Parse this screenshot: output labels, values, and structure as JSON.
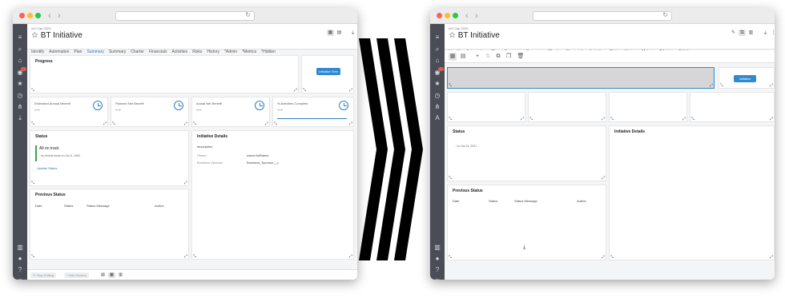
{
  "left": {
    "crumb": "mV Cap 2023",
    "title": "☆ BT Initiative",
    "tabs": [
      "Identify",
      "Automation",
      "Plan",
      "Summary",
      "Summary",
      "Charter",
      "Financials",
      "Activities",
      "Risks",
      "History",
      "*Admin",
      "*Metrics",
      "*Hidden"
    ],
    "active_tab": 3,
    "progress_title": "Progress",
    "button_label": "Initiative Tree",
    "metrics": [
      {
        "label": "Estimated Annual Benefit",
        "value": "---"
      },
      {
        "label": "Planned Net Benefit",
        "value": "---"
      },
      {
        "label": "Actual Net Benefit",
        "value": "---"
      },
      {
        "label": "% Activities Complete",
        "value": "---"
      }
    ],
    "status_title": "Status",
    "status_text": "All on track",
    "status_meta": "- by dennis.trusts on Jun 6, 1963",
    "update_link": "Update Status",
    "details_title": "Initiative Details",
    "details_desc": "description",
    "details_rows": [
      {
        "label": "Owner",
        "value": "owner.fullName"
      },
      {
        "label": "Business Sponsor",
        "value": "Business_Sponsor__c"
      }
    ],
    "prev_title": "Previous Status",
    "prev_headers": [
      "Date",
      "Status",
      "Status Message",
      "Author"
    ],
    "footer_stop": "Stop Editing",
    "footer_add": "Add Section"
  },
  "right": {
    "crumb": "mV Cap 2023",
    "title": "☆ BT Initiative",
    "tabs": [
      "Identify",
      "Automation",
      "Plan",
      "Summary",
      "Summary",
      "Charter",
      "Financials",
      "Activities",
      "Risks",
      "History",
      "*Admin",
      "*Metrics",
      "*Hidden"
    ],
    "active_tab": 3,
    "button_label": "Initiative",
    "status_title": "Status",
    "status_meta": "- on Oct 13, 2021",
    "details_title": "Initiative Details",
    "prev_title": "Previous Status",
    "prev_headers": [
      "Date",
      "Status",
      "Status Message",
      "Author"
    ]
  },
  "colors": {
    "accent": "#1f7ab8",
    "button": "#2f8ad0",
    "rail": "#4a4d55",
    "status_ok": "#3fa34d"
  }
}
